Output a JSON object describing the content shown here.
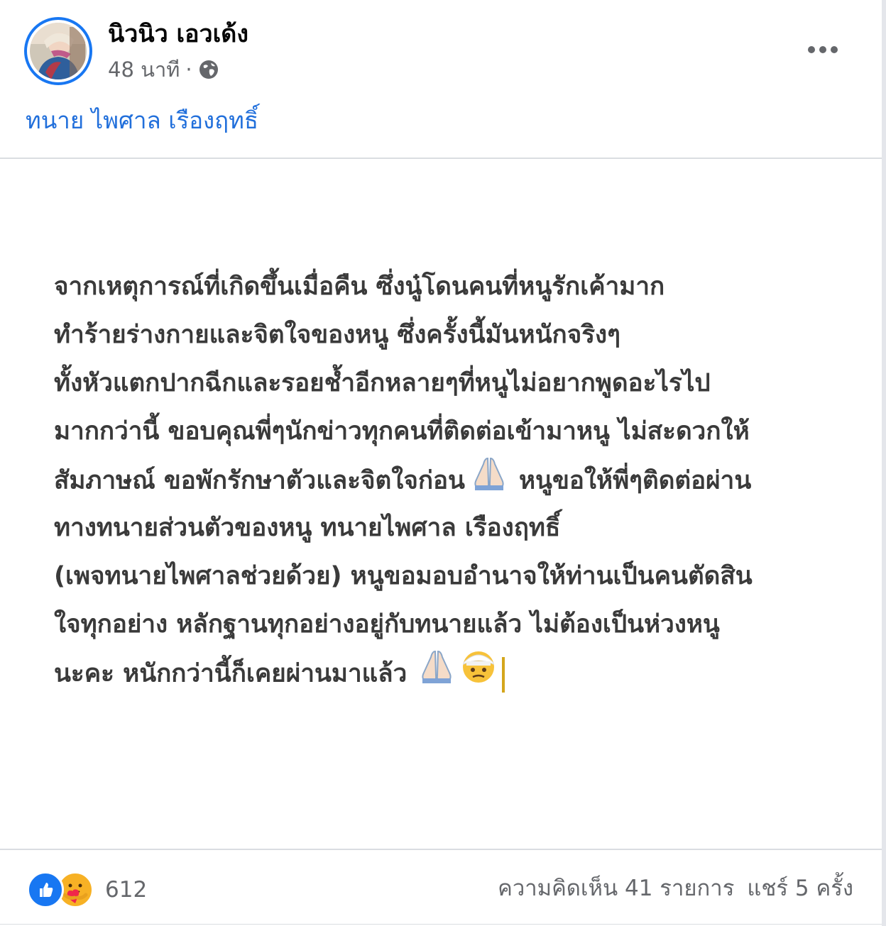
{
  "post": {
    "author": "นิวนิว เอวเด้ง",
    "time": "48 นาที",
    "separator": "·",
    "tagged_link": "ทนาย ไพศาล เรืองฤทธิ์",
    "lines": [
      "จากเหตุการณ์ที่เกิดขึ้นเมื่อคืน ซึ่งนู๋โดนคนที่หนูรักเค้ามาก",
      "ทำร้ายร่างกายและจิตใจของหนู ซึ่งครั้งนี้มันหนักจริงๆ",
      "ทั้งหัวแตกปากฉีกและรอยช้ำอีกหลายๆที่หนูไม่อยากพูดอะไรไป",
      "มากกว่านี้ ขอบคุณพี่ๆนักข่าวทุกคนที่ติดต่อเข้ามาหนู ไม่สะดวกให้",
      "สัมภาษณ์ ขอพักรักษาตัวและจิตใจก่อน",
      "หนูขอให้พี่ๆติดต่อผ่าน",
      "ทางทนายส่วนตัวของหนู ทนายไพศาล เรืองฤทธิ์",
      "(เพจทนายไพศาลช่วยด้วย) หนูขอมอบอำนาจให้ท่านเป็นคนตัดสิน",
      "ใจทุกอย่าง หลักฐานทุกอย่างอยู่กับทนายแล้ว ไม่ต้องเป็นห่วงหนู",
      "นะคะ หนักกว่านี้ก็เคยผ่านมาแล้ว"
    ]
  },
  "footer": {
    "reaction_count": "612",
    "comments": "ความคิดเห็น 41 รายการ",
    "shares": "แชร์ 5 ครั้ง"
  },
  "icons": {
    "privacy": "globe-icon",
    "menu": "more-dots-icon",
    "reaction_1": "like-icon",
    "reaction_2": "care-icon",
    "emoji_1": "folded-hands-icon",
    "emoji_2": "head-bandage-face-icon"
  },
  "colors": {
    "accent": "#1877f2",
    "link": "#216fdb",
    "muted_text": "#65676b",
    "body_text": "#3a3a3a",
    "care": "#f7b125"
  }
}
